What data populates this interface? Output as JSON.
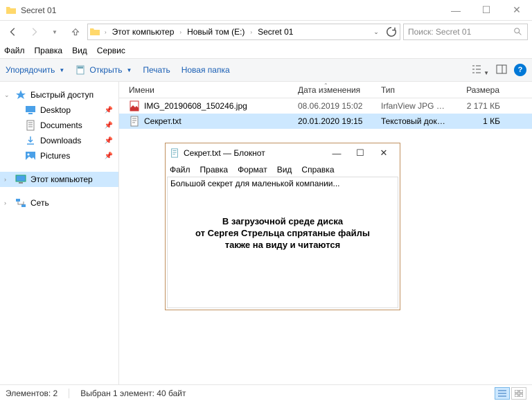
{
  "window": {
    "title": "Secret 01",
    "minimize": "—",
    "maximize": "☐",
    "close": "✕"
  },
  "nav": {
    "crumbs": [
      "Этот компьютер",
      "Новый том (E:)",
      "Secret 01"
    ],
    "search_placeholder": "Поиск: Secret 01"
  },
  "menubar": [
    "Файл",
    "Правка",
    "Вид",
    "Сервис"
  ],
  "toolbar": {
    "organize": "Упорядочить",
    "open": "Открыть",
    "print": "Печать",
    "newfolder": "Новая папка"
  },
  "sidebar": {
    "quick": "Быстрый доступ",
    "desktop": "Desktop",
    "documents": "Documents",
    "downloads": "Downloads",
    "pictures": "Pictures",
    "thispc": "Этот компьютер",
    "network": "Сеть"
  },
  "columns": {
    "name": "Имени",
    "date": "Дата изменения",
    "type": "Тип",
    "size": "Размера"
  },
  "files": [
    {
      "name": "IMG_20190608_150246.jpg",
      "date": "08.06.2019 15:02",
      "type": "IrfanView JPG File",
      "size": "2 171 КБ",
      "icon": "jpg"
    },
    {
      "name": "Секрет.txt",
      "date": "20.01.2020 19:15",
      "type": "Текстовый докум...",
      "size": "1 КБ",
      "icon": "txt"
    }
  ],
  "status": {
    "count": "Элементов: 2",
    "selected": "Выбран 1 элемент: 40 байт"
  },
  "notepad": {
    "title": "Секрет.txt — Блокнот",
    "menu": [
      "Файл",
      "Правка",
      "Формат",
      "Вид",
      "Справка"
    ],
    "text": "Большой секрет для маленькой компании...",
    "overlay1": "В загрузочной среде диска",
    "overlay2": "от Сергея Стрельца спрятаные файлы",
    "overlay3": "также на виду и читаются"
  }
}
